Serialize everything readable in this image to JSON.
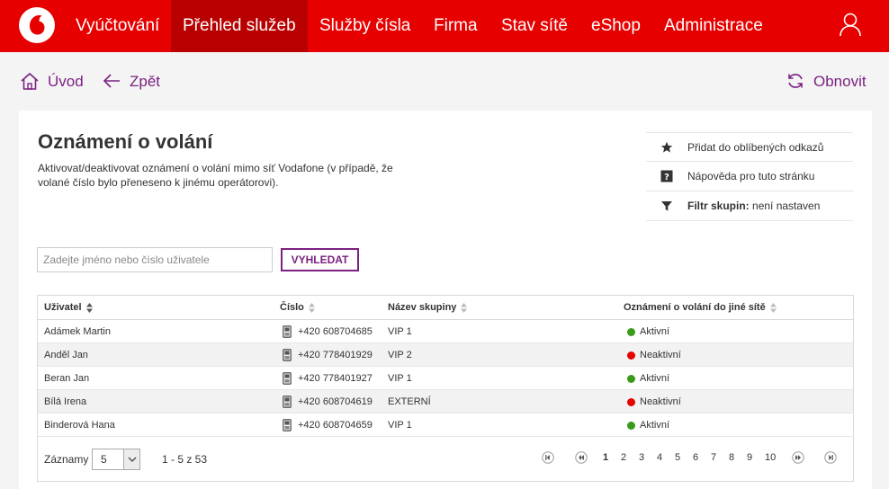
{
  "colors": {
    "brand_red": "#e60000",
    "brand_red_dark": "#b90000",
    "accent_purple": "#7b2181",
    "status_active": "#3a9a1a",
    "status_inactive": "#e60000"
  },
  "nav": {
    "logo_icon": "vodafone-logo",
    "items": [
      {
        "label": "Vyúčtování"
      },
      {
        "label": "Přehled služeb",
        "active": true
      },
      {
        "label": "Služby čísla"
      },
      {
        "label": "Firma"
      },
      {
        "label": "Stav sítě"
      },
      {
        "label": "eShop"
      },
      {
        "label": "Administrace"
      }
    ],
    "user_icon": "user-icon"
  },
  "breadcrumb": {
    "home_label": "Úvod",
    "back_label": "Zpět",
    "refresh_label": "Obnovit"
  },
  "page": {
    "title": "Oznámení o volání",
    "description": "Aktivovat/deaktivovat oznámení o volání mimo síť Vodafone (v případě, že volané číslo bylo přeneseno k jinému operátorovi).",
    "side_links": {
      "favorites": "Přidat do oblíbených odkazů",
      "help": "Nápověda pro tuto stránku",
      "filter_label": "Filtr skupin:",
      "filter_value": "není nastaven"
    }
  },
  "search": {
    "placeholder": "Zadejte jméno nebo číslo uživatele",
    "button_label": "VYHLEDAT"
  },
  "table": {
    "columns": [
      "Uživatel",
      "Číslo",
      "Název skupiny",
      "Oznámení o volání do jiné sítě"
    ],
    "rows": [
      {
        "user": "Adámek Martin",
        "number": "+420 608704685",
        "group": "VIP 1",
        "status": "Aktivní",
        "active": true
      },
      {
        "user": "Anděl Jan",
        "number": "+420 778401929",
        "group": "VIP 2",
        "status": "Neaktivní",
        "active": false
      },
      {
        "user": "Beran Jan",
        "number": "+420 778401927",
        "group": "VIP 1",
        "status": "Aktivní",
        "active": true
      },
      {
        "user": "Bílá Irena",
        "number": "+420 608704619",
        "group": "EXTERNÍ",
        "status": "Neaktivní",
        "active": false
      },
      {
        "user": "Binderová Hana",
        "number": "+420 608704659",
        "group": "VIP 1",
        "status": "Aktivní",
        "active": true
      }
    ],
    "footer": {
      "records_label": "Záznamy",
      "records_value": "5",
      "range_text": "1 - 5 z 53",
      "pages": [
        "1",
        "2",
        "3",
        "4",
        "5",
        "6",
        "7",
        "8",
        "9",
        "10"
      ],
      "current_page": "1"
    }
  }
}
